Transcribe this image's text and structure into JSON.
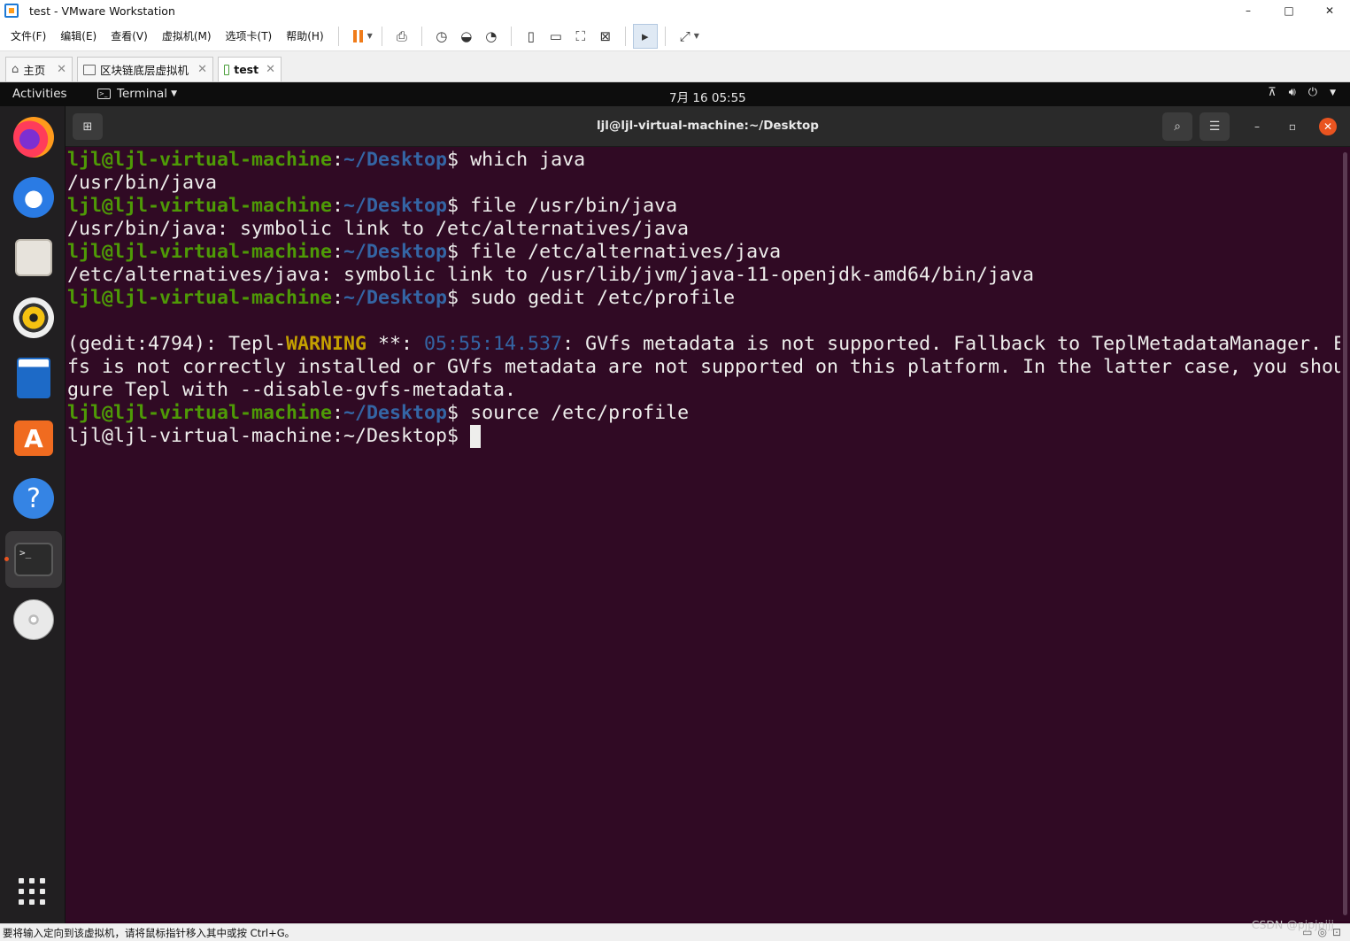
{
  "window": {
    "title": "test - VMware Workstation",
    "controls": [
      "–",
      "□",
      "✕"
    ]
  },
  "menu": [
    "文件(F)",
    "编辑(E)",
    "查看(V)",
    "虚拟机(M)",
    "选项卡(T)",
    "帮助(H)"
  ],
  "tabs": [
    {
      "label": "主页",
      "icon": "home-icon"
    },
    {
      "label": "区块链底层虚拟机",
      "icon": "vm-icon"
    },
    {
      "label": "test",
      "icon": "running-vm-icon",
      "selected": true
    }
  ],
  "gnome": {
    "activities": "Activities",
    "app_menu": "Terminal",
    "clock": "7月 16 05:55"
  },
  "dock": {
    "apps": [
      {
        "name": "firefox-icon"
      },
      {
        "name": "thunderbird-icon"
      },
      {
        "name": "files-icon"
      },
      {
        "name": "rhythmbox-icon"
      },
      {
        "name": "writer-icon"
      },
      {
        "name": "app-center-icon",
        "glyph": "A"
      },
      {
        "name": "help-icon",
        "glyph": "?"
      },
      {
        "name": "terminal-icon",
        "glyph": ">_",
        "active": true
      },
      {
        "name": "dvd-icon"
      }
    ]
  },
  "terminal": {
    "title": "ljl@ljl-virtual-machine:~/Desktop",
    "prompt_user": "ljl@ljl-virtual-machine",
    "prompt_path": "~/Desktop",
    "lines": {
      "l1_cmd": " which java",
      "l2": "/usr/bin/java",
      "l3_cmd": " file /usr/bin/java",
      "l4": "/usr/bin/java: symbolic link to /etc/alternatives/java",
      "l5_cmd": " file /etc/alternatives/java",
      "l6": "/etc/alternatives/java: symbolic link to /usr/lib/jvm/java-11-openjdk-amd64/bin/java",
      "l7_cmd": " sudo gedit /etc/profile",
      "l9_a": "(gedit:4794): Tepl-",
      "l9_warn": "WARNING",
      "l9_b": " **: ",
      "l9_time": "05:55:14.537",
      "l9_c": ": GVfs metadata is not supported. Fallback to TeplMetadataManager. Either GV",
      "l10": "fs is not correctly installed or GVfs metadata are not supported on this platform. In the latter case, you should confi",
      "l11": "gure Tepl with --disable-gvfs-metadata.",
      "l12_cmd": " source /etc/profile",
      "l13": "ljl@ljl-virtual-machine:~/Desktop$ "
    }
  },
  "status": {
    "message": "要将输入定向到该虚拟机，请将鼠标指针移入其中或按 Ctrl+G。",
    "watermark": "CSDN @pjpjpjjj"
  }
}
